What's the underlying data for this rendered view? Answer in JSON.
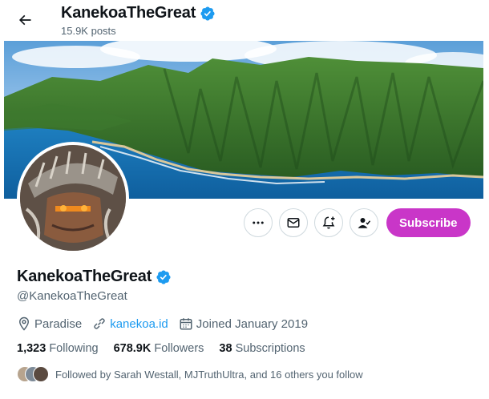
{
  "header": {
    "name": "KanekoaTheGreat",
    "posts": "15.9K posts"
  },
  "profile": {
    "display_name": "KanekoaTheGreat",
    "handle": "@KanekoaTheGreat",
    "location": "Paradise",
    "website": "kanekoa.id",
    "joined": "Joined January 2019"
  },
  "actions": {
    "subscribe_label": "Subscribe"
  },
  "stats": {
    "following_count": "1,323",
    "following_label": "Following",
    "followers_count": "678.9K",
    "followers_label": "Followers",
    "subscriptions_count": "38",
    "subscriptions_label": "Subscriptions"
  },
  "followed_by": "Followed by Sarah Westall, MJTruthUltra, and 16 others you follow",
  "colors": {
    "verified": "#1d9bf0",
    "subscribe": "#c936c8",
    "link": "#1d9bf0"
  },
  "icons": {
    "back": "arrow-left-icon",
    "verified": "verified-badge-icon",
    "more": "more-icon",
    "message": "envelope-icon",
    "notify": "bell-plus-icon",
    "following": "person-check-icon",
    "location": "location-pin-icon",
    "link": "link-icon",
    "calendar": "calendar-icon"
  }
}
